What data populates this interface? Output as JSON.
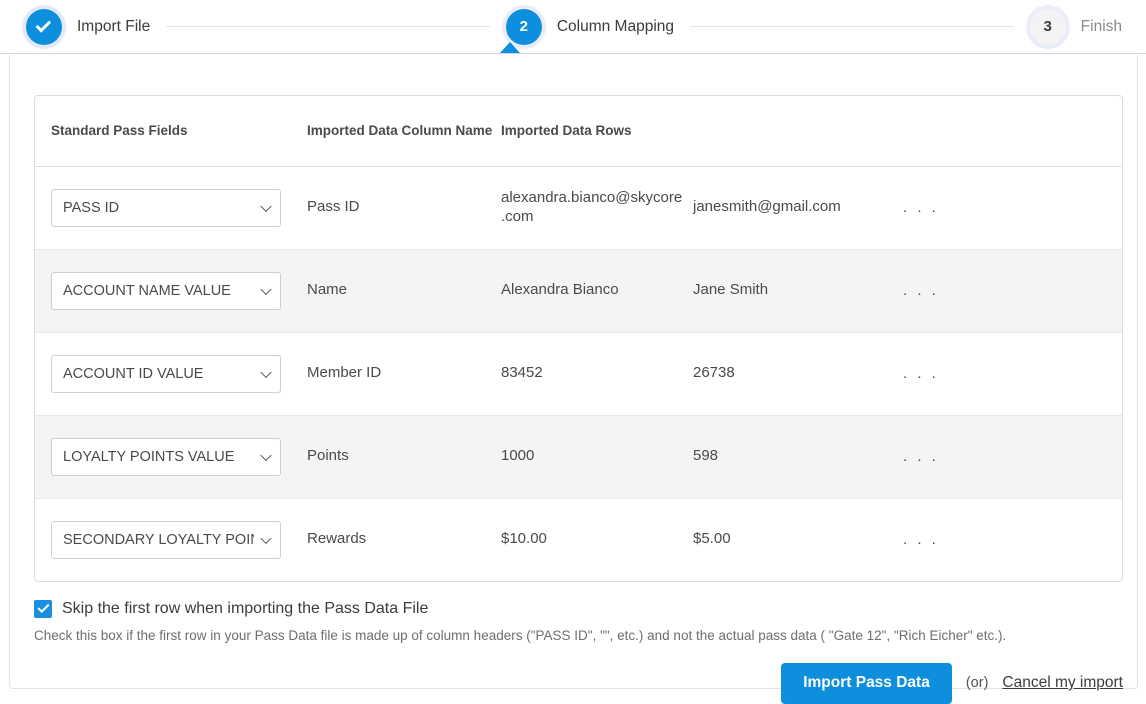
{
  "stepper": {
    "steps": [
      {
        "label": "Import File",
        "marker": "check",
        "state": "done",
        "icon": "check-icon"
      },
      {
        "label": "Column Mapping",
        "marker": "2",
        "state": "active",
        "icon": "step-number"
      },
      {
        "label": "Finish",
        "marker": "3",
        "state": "todo",
        "icon": "step-number"
      }
    ],
    "active_pointer_icon": "triangle-up-icon"
  },
  "accent_colors": {
    "primary_blue": "#0d8fdd",
    "checkbox_blue": "#1b8fe0",
    "divider_lavender": "#ccd3ec",
    "alt_row_gray": "#f4f4f4"
  },
  "table": {
    "headers": [
      "Standard Pass Fields",
      "Imported Data Column Name",
      "Imported Data Rows"
    ],
    "ellipsis": ". . .",
    "chevron_icon": "chevron-down-icon",
    "rows": [
      {
        "field": "PASS ID",
        "column_name": "Pass ID",
        "value1": "alexandra.bianco@skycore.com",
        "value2": "janesmith@gmail.com",
        "more": ". . ."
      },
      {
        "field": "ACCOUNT NAME VALUE",
        "column_name": "Name",
        "value1": "Alexandra Bianco",
        "value2": "Jane Smith",
        "more": ". . ."
      },
      {
        "field": "ACCOUNT ID VALUE",
        "column_name": "Member ID",
        "value1": "83452",
        "value2": "26738",
        "more": ". . ."
      },
      {
        "field": "LOYALTY POINTS VALUE",
        "column_name": "Points",
        "value1": "1000",
        "value2": "598",
        "more": ". . ."
      },
      {
        "field": "SECONDARY LOYALTY POINTS VALUE",
        "column_name": "Rewards",
        "value1": "$10.00",
        "value2": "$5.00",
        "more": ". . ."
      }
    ]
  },
  "options": {
    "skip_first_row": {
      "checked": true,
      "label": "Skip the first row when importing the Pass Data File",
      "help": "Check this box if the first row in your Pass Data file is made up of column headers (\"PASS ID\", \"\", etc.) and not the actual pass data ( \"Gate 12\", \"Rich Eicher\" etc.)."
    }
  },
  "footer": {
    "import_button": "Import Pass Data",
    "or_text": "(or)",
    "cancel_link": "Cancel my import"
  }
}
